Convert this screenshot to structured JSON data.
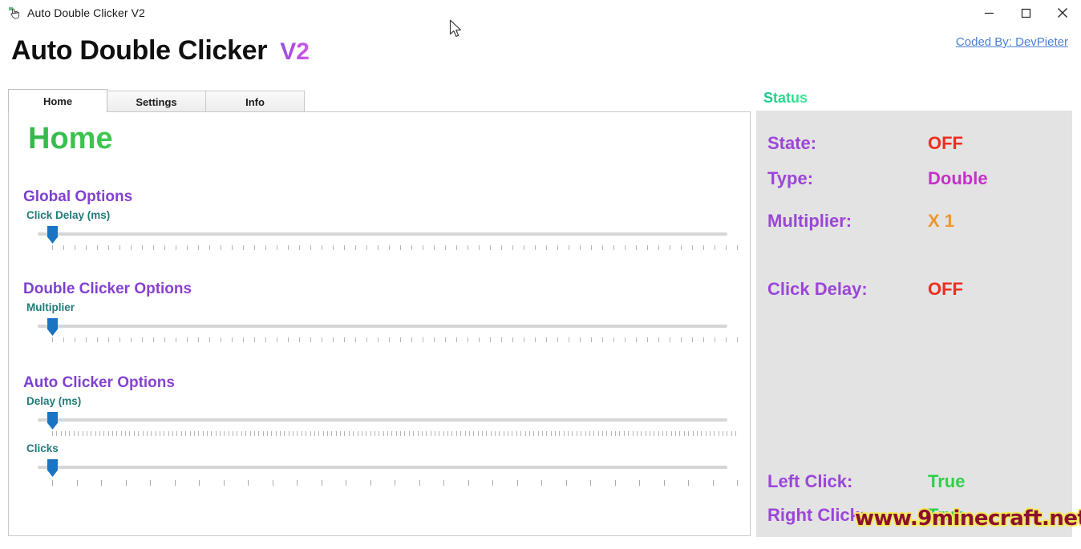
{
  "window": {
    "title": "Auto Double Clicker V2",
    "icon": "hand-pointer-icon",
    "minimize_label": "─",
    "maximize_label": "□",
    "close_label": "✕"
  },
  "header": {
    "app_title": "Auto Double Clicker",
    "version": "V2",
    "credit": "Coded By: DevPieter"
  },
  "tabs": [
    {
      "label": "Home",
      "active": true
    },
    {
      "label": "Settings",
      "active": false
    },
    {
      "label": "Info",
      "active": false
    }
  ],
  "main": {
    "page_heading": "Home",
    "sections": [
      {
        "title": "Global Options",
        "fields": [
          {
            "label": "Click Delay (ms)",
            "tick_count": 62,
            "dense": true,
            "thumb_pct": 0
          }
        ]
      },
      {
        "title": "Double Clicker Options",
        "fields": [
          {
            "label": "Multiplier",
            "tick_count": 62,
            "dense": true,
            "thumb_pct": 0
          }
        ]
      },
      {
        "title": "Auto Clicker Options",
        "fields": [
          {
            "label": "Delay (ms)",
            "tick_count": 160,
            "dense": true,
            "thumb_pct": 0
          },
          {
            "label": "Clicks",
            "tick_count": 29,
            "dense": false,
            "thumb_pct": 0
          }
        ]
      }
    ]
  },
  "status": {
    "title": "Status",
    "rows": [
      {
        "key": "State:",
        "value": "OFF",
        "value_class": "v-off"
      },
      {
        "key": "Type:",
        "value": "Double",
        "value_class": "v-type"
      },
      {
        "key": "Multiplier:",
        "value": "X 1",
        "value_class": "v-mult"
      },
      {
        "key": "Click Delay:",
        "value": "OFF",
        "value_class": "v-off"
      },
      {
        "key": "Left Click:",
        "value": "True",
        "value_class": "v-true"
      },
      {
        "key": "Right Click:",
        "value": "True",
        "value_class": "v-true"
      }
    ]
  },
  "watermark": {
    "text": "www.9minecraft.net"
  },
  "colors": {
    "accent_purple": "#9b46d8",
    "accent_green": "#33b84a",
    "accent_teal": "#1f7a78",
    "slider_thumb": "#1a74c4",
    "status_bg": "#e3e3e3",
    "off_red": "#ee2d1e",
    "true_green": "#2fd04a",
    "multiplier_orange": "#f0962a",
    "link_blue": "#4a7fd6"
  }
}
